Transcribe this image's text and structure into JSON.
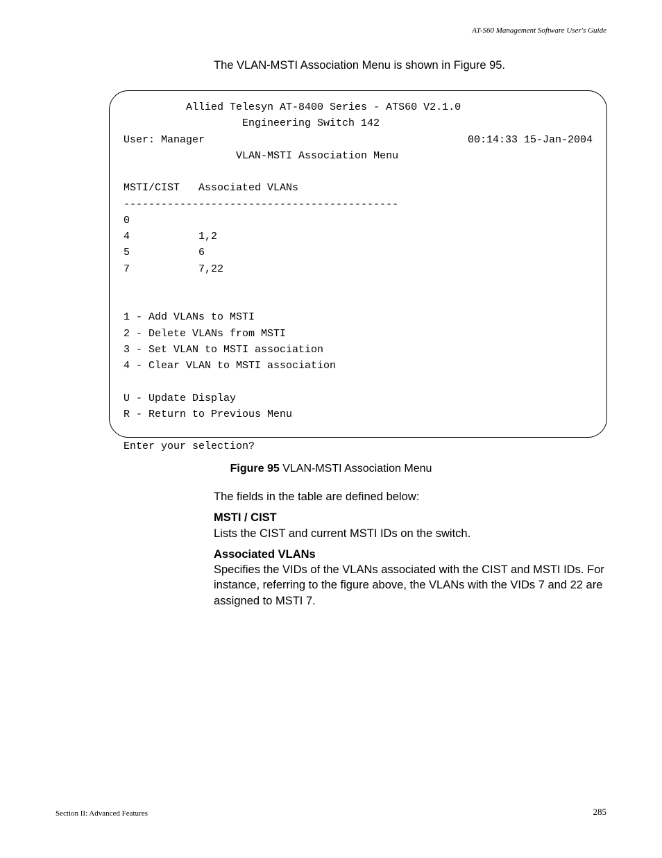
{
  "header": {
    "doc_title": "AT-S60 Management Software User's Guide"
  },
  "intro": "The VLAN-MSTI Association Menu is shown in Figure 95.",
  "terminal": {
    "title_line1": "Allied Telesyn AT-8400 Series - ATS60 V2.1.0",
    "title_line2": "Engineering Switch 142",
    "user_label": "User: Manager",
    "timestamp": "00:14:33 15-Jan-2004",
    "menu_title": "VLAN-MSTI Association Menu",
    "table_header": "MSTI/CIST   Associated VLANs",
    "separator": "--------------------------------------------",
    "rows": [
      {
        "msti": "0",
        "vlans": ""
      },
      {
        "msti": "4",
        "vlans": "1,2"
      },
      {
        "msti": "5",
        "vlans": "6"
      },
      {
        "msti": "7",
        "vlans": "7,22"
      }
    ],
    "options": [
      "1 - Add VLANs to MSTI",
      "2 - Delete VLANs from MSTI",
      "3 - Set VLAN to MSTI association",
      "4 - Clear VLAN to MSTI association"
    ],
    "nav_options": [
      "U - Update Display",
      "R - Return to Previous Menu"
    ],
    "prompt": "Enter your selection?"
  },
  "figure": {
    "label": "Figure 95",
    "caption": "  VLAN-MSTI Association Menu"
  },
  "defs_intro": "The fields in the table are defined below:",
  "definitions": [
    {
      "title": "MSTI / CIST",
      "body": "Lists the CIST and current MSTI IDs on the switch."
    },
    {
      "title": "Associated VLANs",
      "body": "Specifies the VIDs of the VLANs associated with the CIST and MSTI IDs. For instance, referring to the figure above, the VLANs with the VIDs 7 and 22 are assigned to MSTI 7."
    }
  ],
  "footer": {
    "section": "Section II: Advanced Features",
    "page": "285"
  }
}
